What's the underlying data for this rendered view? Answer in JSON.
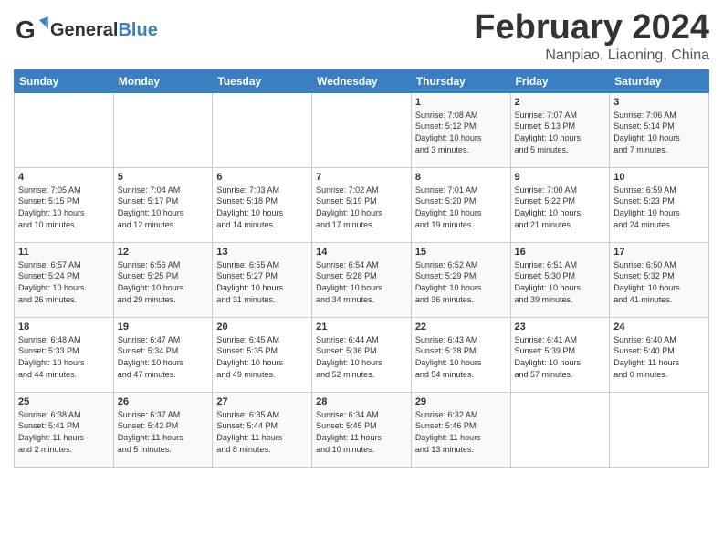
{
  "logo": {
    "general": "General",
    "blue": "Blue"
  },
  "title": {
    "month_year": "February 2024",
    "location": "Nanpiao, Liaoning, China"
  },
  "headers": [
    "Sunday",
    "Monday",
    "Tuesday",
    "Wednesday",
    "Thursday",
    "Friday",
    "Saturday"
  ],
  "weeks": [
    [
      {
        "day": "",
        "info": ""
      },
      {
        "day": "",
        "info": ""
      },
      {
        "day": "",
        "info": ""
      },
      {
        "day": "",
        "info": ""
      },
      {
        "day": "1",
        "info": "Sunrise: 7:08 AM\nSunset: 5:12 PM\nDaylight: 10 hours\nand 3 minutes."
      },
      {
        "day": "2",
        "info": "Sunrise: 7:07 AM\nSunset: 5:13 PM\nDaylight: 10 hours\nand 5 minutes."
      },
      {
        "day": "3",
        "info": "Sunrise: 7:06 AM\nSunset: 5:14 PM\nDaylight: 10 hours\nand 7 minutes."
      }
    ],
    [
      {
        "day": "4",
        "info": "Sunrise: 7:05 AM\nSunset: 5:15 PM\nDaylight: 10 hours\nand 10 minutes."
      },
      {
        "day": "5",
        "info": "Sunrise: 7:04 AM\nSunset: 5:17 PM\nDaylight: 10 hours\nand 12 minutes."
      },
      {
        "day": "6",
        "info": "Sunrise: 7:03 AM\nSunset: 5:18 PM\nDaylight: 10 hours\nand 14 minutes."
      },
      {
        "day": "7",
        "info": "Sunrise: 7:02 AM\nSunset: 5:19 PM\nDaylight: 10 hours\nand 17 minutes."
      },
      {
        "day": "8",
        "info": "Sunrise: 7:01 AM\nSunset: 5:20 PM\nDaylight: 10 hours\nand 19 minutes."
      },
      {
        "day": "9",
        "info": "Sunrise: 7:00 AM\nSunset: 5:22 PM\nDaylight: 10 hours\nand 21 minutes."
      },
      {
        "day": "10",
        "info": "Sunrise: 6:59 AM\nSunset: 5:23 PM\nDaylight: 10 hours\nand 24 minutes."
      }
    ],
    [
      {
        "day": "11",
        "info": "Sunrise: 6:57 AM\nSunset: 5:24 PM\nDaylight: 10 hours\nand 26 minutes."
      },
      {
        "day": "12",
        "info": "Sunrise: 6:56 AM\nSunset: 5:25 PM\nDaylight: 10 hours\nand 29 minutes."
      },
      {
        "day": "13",
        "info": "Sunrise: 6:55 AM\nSunset: 5:27 PM\nDaylight: 10 hours\nand 31 minutes."
      },
      {
        "day": "14",
        "info": "Sunrise: 6:54 AM\nSunset: 5:28 PM\nDaylight: 10 hours\nand 34 minutes."
      },
      {
        "day": "15",
        "info": "Sunrise: 6:52 AM\nSunset: 5:29 PM\nDaylight: 10 hours\nand 36 minutes."
      },
      {
        "day": "16",
        "info": "Sunrise: 6:51 AM\nSunset: 5:30 PM\nDaylight: 10 hours\nand 39 minutes."
      },
      {
        "day": "17",
        "info": "Sunrise: 6:50 AM\nSunset: 5:32 PM\nDaylight: 10 hours\nand 41 minutes."
      }
    ],
    [
      {
        "day": "18",
        "info": "Sunrise: 6:48 AM\nSunset: 5:33 PM\nDaylight: 10 hours\nand 44 minutes."
      },
      {
        "day": "19",
        "info": "Sunrise: 6:47 AM\nSunset: 5:34 PM\nDaylight: 10 hours\nand 47 minutes."
      },
      {
        "day": "20",
        "info": "Sunrise: 6:45 AM\nSunset: 5:35 PM\nDaylight: 10 hours\nand 49 minutes."
      },
      {
        "day": "21",
        "info": "Sunrise: 6:44 AM\nSunset: 5:36 PM\nDaylight: 10 hours\nand 52 minutes."
      },
      {
        "day": "22",
        "info": "Sunrise: 6:43 AM\nSunset: 5:38 PM\nDaylight: 10 hours\nand 54 minutes."
      },
      {
        "day": "23",
        "info": "Sunrise: 6:41 AM\nSunset: 5:39 PM\nDaylight: 10 hours\nand 57 minutes."
      },
      {
        "day": "24",
        "info": "Sunrise: 6:40 AM\nSunset: 5:40 PM\nDaylight: 11 hours\nand 0 minutes."
      }
    ],
    [
      {
        "day": "25",
        "info": "Sunrise: 6:38 AM\nSunset: 5:41 PM\nDaylight: 11 hours\nand 2 minutes."
      },
      {
        "day": "26",
        "info": "Sunrise: 6:37 AM\nSunset: 5:42 PM\nDaylight: 11 hours\nand 5 minutes."
      },
      {
        "day": "27",
        "info": "Sunrise: 6:35 AM\nSunset: 5:44 PM\nDaylight: 11 hours\nand 8 minutes."
      },
      {
        "day": "28",
        "info": "Sunrise: 6:34 AM\nSunset: 5:45 PM\nDaylight: 11 hours\nand 10 minutes."
      },
      {
        "day": "29",
        "info": "Sunrise: 6:32 AM\nSunset: 5:46 PM\nDaylight: 11 hours\nand 13 minutes."
      },
      {
        "day": "",
        "info": ""
      },
      {
        "day": "",
        "info": ""
      }
    ]
  ]
}
